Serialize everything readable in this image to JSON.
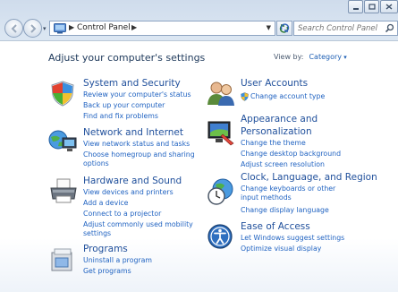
{
  "window": {
    "buttons": {
      "minimize": "minimize-icon",
      "maximize": "maximize-icon",
      "close": "close-icon"
    }
  },
  "nav": {
    "breadcrumb": "Control Panel",
    "search_placeholder": "Search Control Panel"
  },
  "content": {
    "heading": "Adjust your computer's settings",
    "view_by_label": "View by:",
    "view_by_value": "Category"
  },
  "categories": [
    {
      "title": "System and Security",
      "icon": "shield-flag-icon",
      "links": [
        "Review your computer's status",
        "Back up your computer",
        "Find and fix problems"
      ]
    },
    {
      "title": "Network and Internet",
      "icon": "network-globe-icon",
      "links": [
        "View network status and tasks",
        "Choose homegroup and sharing options"
      ]
    },
    {
      "title": "Hardware and Sound",
      "icon": "printer-icon",
      "links": [
        "View devices and printers",
        "Add a device",
        "Connect to a projector",
        "Adjust commonly used mobility settings"
      ]
    },
    {
      "title": "Programs",
      "icon": "programs-icon",
      "links": [
        "Uninstall a program",
        "Get programs"
      ]
    },
    {
      "title": "User Accounts",
      "icon": "users-icon",
      "links": [
        "Change account type"
      ]
    },
    {
      "title": "Appearance and Personalization",
      "title_line1": "Appearance and",
      "title_line2": "Personalization",
      "icon": "appearance-icon",
      "links": [
        "Change the theme",
        "Change desktop background",
        "Adjust screen resolution"
      ]
    },
    {
      "title": "Clock, Language, and Region",
      "icon": "clock-globe-icon",
      "links": [
        "Change keyboards or other input methods",
        "Change display language"
      ]
    },
    {
      "title": "Ease of Access",
      "icon": "ease-of-access-icon",
      "links": [
        "Let Windows suggest settings",
        "Optimize visual display"
      ]
    }
  ],
  "colors": {
    "link": "#1f62c1",
    "title": "#1f4f9b",
    "heading": "#1e395b"
  }
}
